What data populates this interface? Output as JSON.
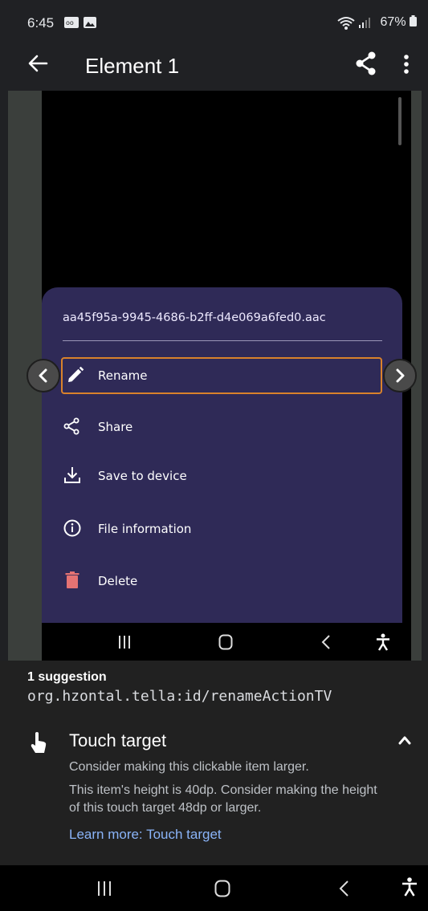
{
  "status_bar": {
    "time": "6:45",
    "battery": "67%"
  },
  "app_bar": {
    "title": "Element 1"
  },
  "sheet": {
    "filename": "aa45f95a-9945-4686-b2ff-d4e069a6fed0.aac",
    "items": [
      {
        "label": "Rename",
        "icon": "pencil-icon"
      },
      {
        "label": "Share",
        "icon": "share-icon"
      },
      {
        "label": "Save to device",
        "icon": "download-icon"
      },
      {
        "label": "File information",
        "icon": "info-icon"
      },
      {
        "label": "Delete",
        "icon": "trash-icon"
      }
    ],
    "accent_highlight": "#d9822b",
    "delete_color": "#e57373"
  },
  "suggestion": {
    "count": "1 suggestion",
    "view_id": "org.hzontal.tella:id/renameActionTV",
    "title": "Touch target",
    "line1": "Consider making this clickable item larger.",
    "line2": "This item's height is 40dp. Consider making the height of this touch target 48dp or larger.",
    "link": "Learn more: Touch target"
  }
}
